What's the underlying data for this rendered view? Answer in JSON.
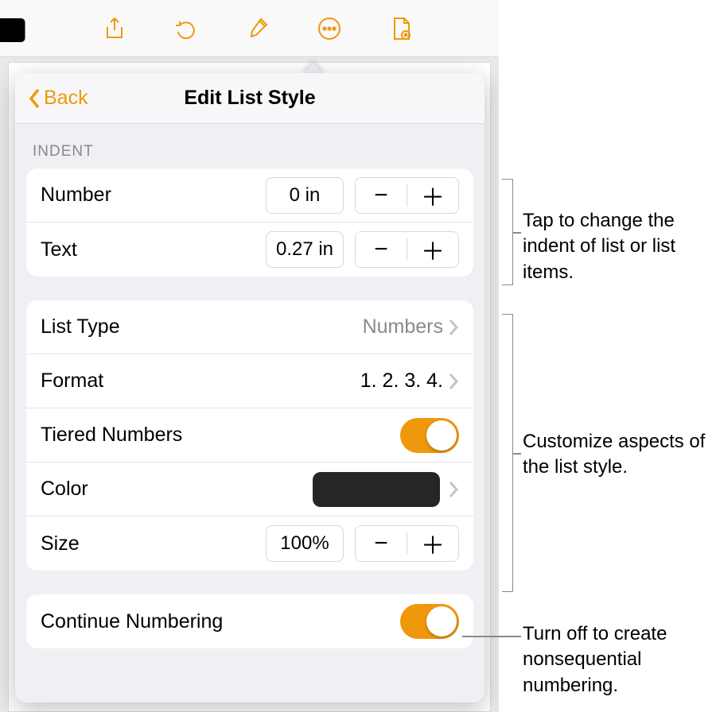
{
  "toolbar": {
    "icons": [
      "media-icon",
      "share-icon",
      "undo-icon",
      "format-brush-icon",
      "more-icon",
      "document-options-icon"
    ]
  },
  "popover": {
    "back_label": "Back",
    "title": "Edit List Style",
    "indent_section_label": "INDENT",
    "indent_number": {
      "label": "Number",
      "value": "0 in"
    },
    "indent_text": {
      "label": "Text",
      "value": "0.27 in"
    },
    "list_type": {
      "label": "List Type",
      "value": "Numbers"
    },
    "format": {
      "label": "Format",
      "value": "1. 2. 3. 4."
    },
    "tiered": {
      "label": "Tiered Numbers",
      "on": true
    },
    "color": {
      "label": "Color",
      "swatch": "#262626"
    },
    "size": {
      "label": "Size",
      "value": "100%"
    },
    "continue": {
      "label": "Continue Numbering",
      "on": true
    }
  },
  "callouts": {
    "indent": "Tap to change the indent of list or list items.",
    "style": "Customize aspects of the list style.",
    "continue": "Turn off to create nonsequential numbering."
  }
}
